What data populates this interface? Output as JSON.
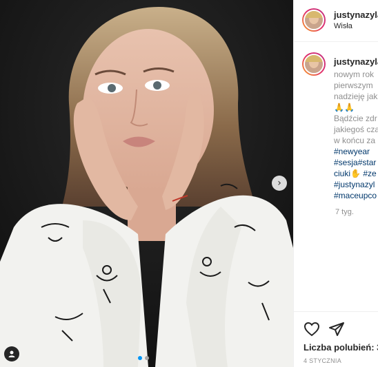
{
  "post": {
    "username": "justynazyla",
    "location": "Wisła",
    "caption_lines": [
      "nowym rok",
      "pierwszym",
      "nadzieję jak",
      "🙏🙏",
      "Bądźcie zdr",
      "jakiegoś cza",
      "w końcu za"
    ],
    "hashtag_lines": [
      "#newyear",
      "#sesja#star",
      "ciuki",
      "#justynazyl",
      "#maceupco"
    ],
    "ciuki_suffix": "#ze",
    "time_ago": "7 tyg.",
    "likes_label": "Liczba polubień: 3",
    "date": "4 STYCZNIA",
    "carousel": {
      "slides": 2,
      "current": 1
    }
  },
  "icons": {
    "next": "chevron-right-icon",
    "tag": "user-tag-icon",
    "like": "heart-icon",
    "share": "paper-plane-icon"
  },
  "colors": {
    "link": "#00376b",
    "muted": "#8e8e8e",
    "text": "#262626",
    "dot_active": "#0095f6"
  }
}
